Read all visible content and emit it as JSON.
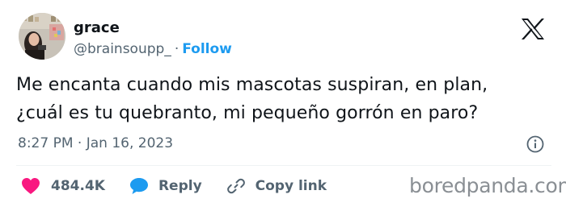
{
  "user": {
    "display_name": "grace",
    "handle": "@brainsoupp_",
    "separator": "·",
    "follow_label": "Follow"
  },
  "tweet": {
    "text_line1": "Me encanta cuando mis mascotas suspiran, en plan,",
    "text_line2": "¿cuál es tu quebranto, mi pequeño gorrón en paro?",
    "timestamp": "8:27 PM · Jan 16, 2023"
  },
  "actions": {
    "like_count": "484.4K",
    "reply_label": "Reply",
    "copy_link_label": "Copy link"
  },
  "icons": {
    "logo": "x-logo-icon",
    "info": "info-icon",
    "like": "heart-icon",
    "reply": "speech-bubble-icon",
    "copy": "link-icon"
  },
  "colors": {
    "follow": "#1d9bf0",
    "heart": "#f91880",
    "reply": "#1d9bf0",
    "text": "#0f1419",
    "secondary": "#536471"
  },
  "watermark": "boredpanda.com"
}
